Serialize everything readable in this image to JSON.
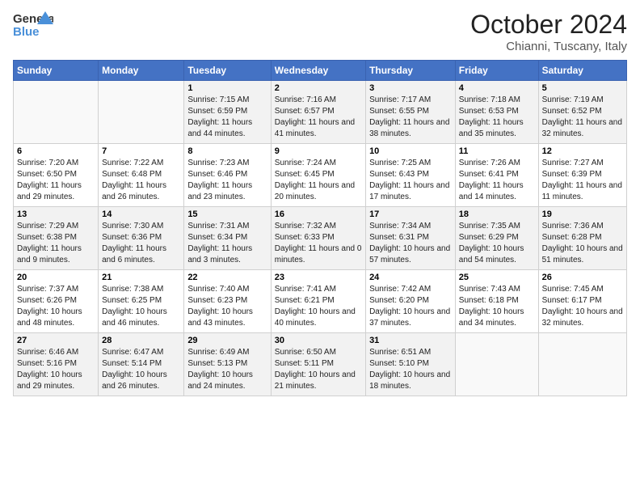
{
  "logo": {
    "line1": "General",
    "line2": "Blue"
  },
  "header": {
    "month": "October 2024",
    "location": "Chianni, Tuscany, Italy"
  },
  "days_of_week": [
    "Sunday",
    "Monday",
    "Tuesday",
    "Wednesday",
    "Thursday",
    "Friday",
    "Saturday"
  ],
  "weeks": [
    [
      {
        "day": "",
        "info": ""
      },
      {
        "day": "",
        "info": ""
      },
      {
        "day": "1",
        "info": "Sunrise: 7:15 AM\nSunset: 6:59 PM\nDaylight: 11 hours and 44 minutes."
      },
      {
        "day": "2",
        "info": "Sunrise: 7:16 AM\nSunset: 6:57 PM\nDaylight: 11 hours and 41 minutes."
      },
      {
        "day": "3",
        "info": "Sunrise: 7:17 AM\nSunset: 6:55 PM\nDaylight: 11 hours and 38 minutes."
      },
      {
        "day": "4",
        "info": "Sunrise: 7:18 AM\nSunset: 6:53 PM\nDaylight: 11 hours and 35 minutes."
      },
      {
        "day": "5",
        "info": "Sunrise: 7:19 AM\nSunset: 6:52 PM\nDaylight: 11 hours and 32 minutes."
      }
    ],
    [
      {
        "day": "6",
        "info": "Sunrise: 7:20 AM\nSunset: 6:50 PM\nDaylight: 11 hours and 29 minutes."
      },
      {
        "day": "7",
        "info": "Sunrise: 7:22 AM\nSunset: 6:48 PM\nDaylight: 11 hours and 26 minutes."
      },
      {
        "day": "8",
        "info": "Sunrise: 7:23 AM\nSunset: 6:46 PM\nDaylight: 11 hours and 23 minutes."
      },
      {
        "day": "9",
        "info": "Sunrise: 7:24 AM\nSunset: 6:45 PM\nDaylight: 11 hours and 20 minutes."
      },
      {
        "day": "10",
        "info": "Sunrise: 7:25 AM\nSunset: 6:43 PM\nDaylight: 11 hours and 17 minutes."
      },
      {
        "day": "11",
        "info": "Sunrise: 7:26 AM\nSunset: 6:41 PM\nDaylight: 11 hours and 14 minutes."
      },
      {
        "day": "12",
        "info": "Sunrise: 7:27 AM\nSunset: 6:39 PM\nDaylight: 11 hours and 11 minutes."
      }
    ],
    [
      {
        "day": "13",
        "info": "Sunrise: 7:29 AM\nSunset: 6:38 PM\nDaylight: 11 hours and 9 minutes."
      },
      {
        "day": "14",
        "info": "Sunrise: 7:30 AM\nSunset: 6:36 PM\nDaylight: 11 hours and 6 minutes."
      },
      {
        "day": "15",
        "info": "Sunrise: 7:31 AM\nSunset: 6:34 PM\nDaylight: 11 hours and 3 minutes."
      },
      {
        "day": "16",
        "info": "Sunrise: 7:32 AM\nSunset: 6:33 PM\nDaylight: 11 hours and 0 minutes."
      },
      {
        "day": "17",
        "info": "Sunrise: 7:34 AM\nSunset: 6:31 PM\nDaylight: 10 hours and 57 minutes."
      },
      {
        "day": "18",
        "info": "Sunrise: 7:35 AM\nSunset: 6:29 PM\nDaylight: 10 hours and 54 minutes."
      },
      {
        "day": "19",
        "info": "Sunrise: 7:36 AM\nSunset: 6:28 PM\nDaylight: 10 hours and 51 minutes."
      }
    ],
    [
      {
        "day": "20",
        "info": "Sunrise: 7:37 AM\nSunset: 6:26 PM\nDaylight: 10 hours and 48 minutes."
      },
      {
        "day": "21",
        "info": "Sunrise: 7:38 AM\nSunset: 6:25 PM\nDaylight: 10 hours and 46 minutes."
      },
      {
        "day": "22",
        "info": "Sunrise: 7:40 AM\nSunset: 6:23 PM\nDaylight: 10 hours and 43 minutes."
      },
      {
        "day": "23",
        "info": "Sunrise: 7:41 AM\nSunset: 6:21 PM\nDaylight: 10 hours and 40 minutes."
      },
      {
        "day": "24",
        "info": "Sunrise: 7:42 AM\nSunset: 6:20 PM\nDaylight: 10 hours and 37 minutes."
      },
      {
        "day": "25",
        "info": "Sunrise: 7:43 AM\nSunset: 6:18 PM\nDaylight: 10 hours and 34 minutes."
      },
      {
        "day": "26",
        "info": "Sunrise: 7:45 AM\nSunset: 6:17 PM\nDaylight: 10 hours and 32 minutes."
      }
    ],
    [
      {
        "day": "27",
        "info": "Sunrise: 6:46 AM\nSunset: 5:16 PM\nDaylight: 10 hours and 29 minutes."
      },
      {
        "day": "28",
        "info": "Sunrise: 6:47 AM\nSunset: 5:14 PM\nDaylight: 10 hours and 26 minutes."
      },
      {
        "day": "29",
        "info": "Sunrise: 6:49 AM\nSunset: 5:13 PM\nDaylight: 10 hours and 24 minutes."
      },
      {
        "day": "30",
        "info": "Sunrise: 6:50 AM\nSunset: 5:11 PM\nDaylight: 10 hours and 21 minutes."
      },
      {
        "day": "31",
        "info": "Sunrise: 6:51 AM\nSunset: 5:10 PM\nDaylight: 10 hours and 18 minutes."
      },
      {
        "day": "",
        "info": ""
      },
      {
        "day": "",
        "info": ""
      }
    ]
  ]
}
